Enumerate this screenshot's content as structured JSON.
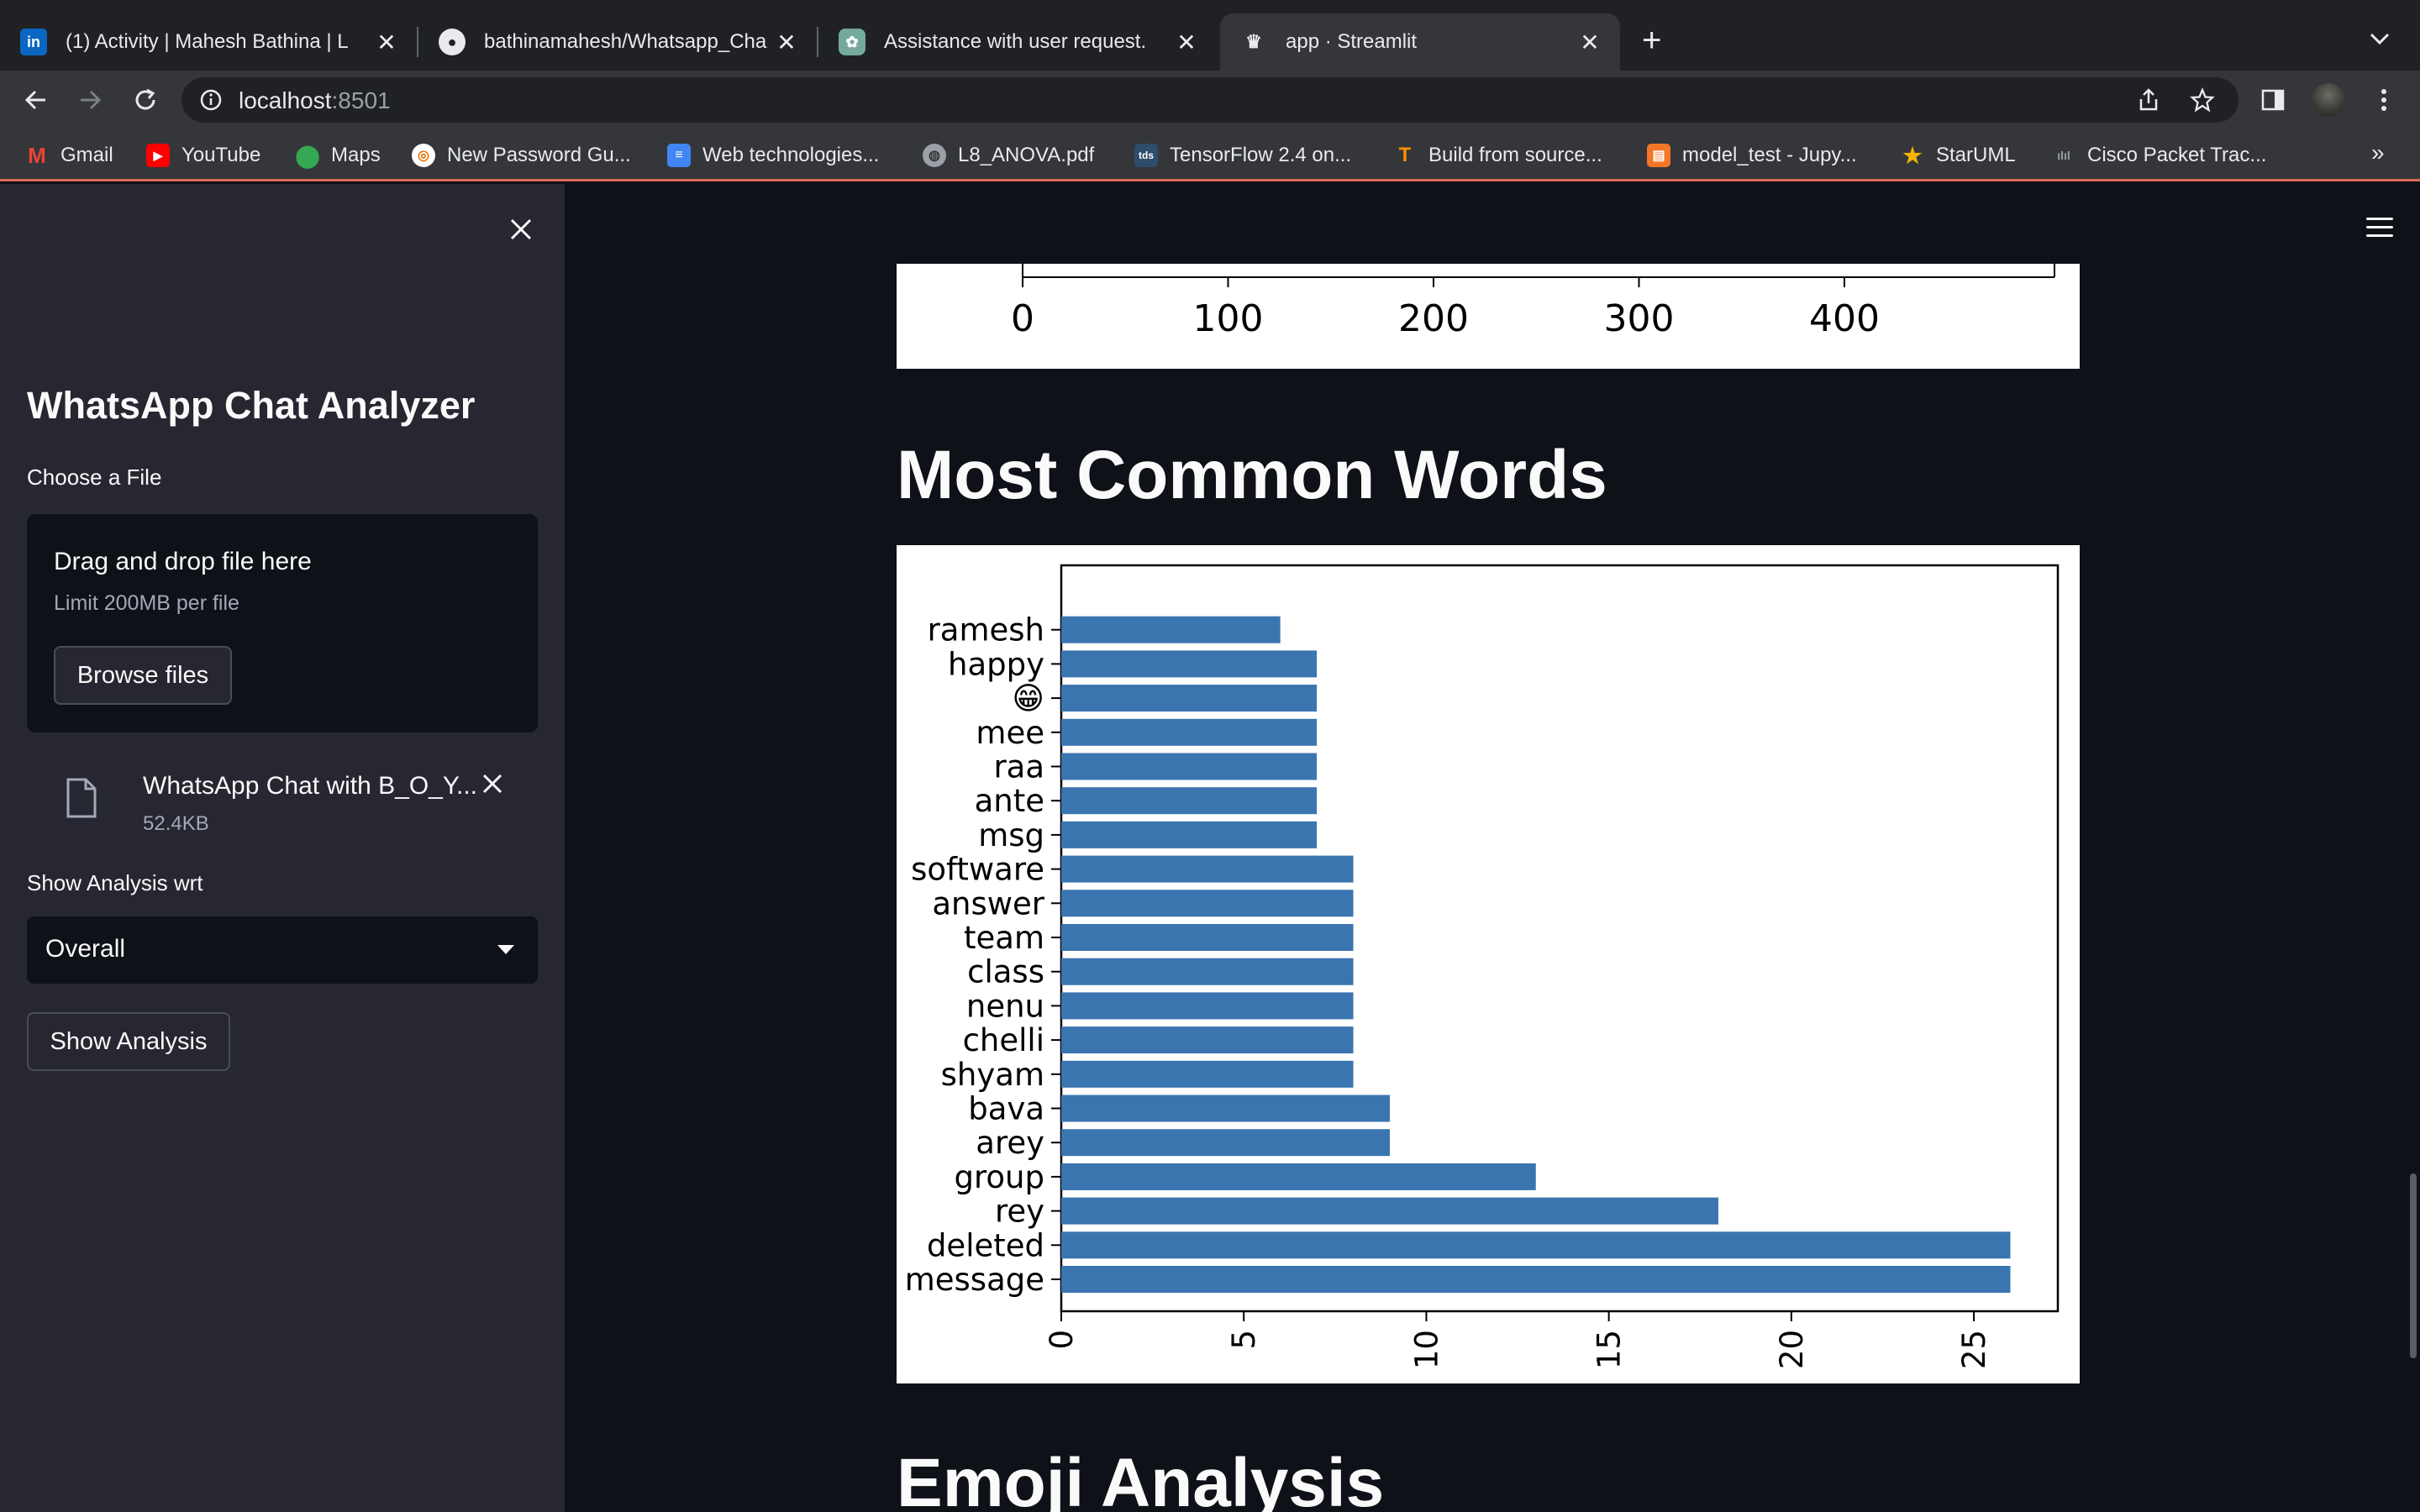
{
  "browser": {
    "tabs": [
      {
        "title": "(1) Activity | Mahesh Bathina | L",
        "icon": "linkedin-icon",
        "active": false
      },
      {
        "title": "bathinamahesh/Whatsapp_Cha",
        "icon": "github-icon",
        "active": false
      },
      {
        "title": "Assistance with user request.",
        "icon": "chatgpt-icon",
        "active": false
      },
      {
        "title": "app · Streamlit",
        "icon": "streamlit-icon",
        "active": true
      }
    ],
    "url_host": "localhost",
    "url_port": ":8501",
    "bookmarks": [
      {
        "label": "Gmail",
        "icon": "gmail-icon"
      },
      {
        "label": "YouTube",
        "icon": "youtube-icon"
      },
      {
        "label": "Maps",
        "icon": "maps-icon"
      },
      {
        "label": "New Password Gu...",
        "icon": "password-icon"
      },
      {
        "label": "Web technologies...",
        "icon": "docs-icon"
      },
      {
        "label": "L8_ANOVA.pdf",
        "icon": "globe-icon"
      },
      {
        "label": "TensorFlow 2.4 on...",
        "icon": "tds-icon"
      },
      {
        "label": "Build from source...",
        "icon": "tensorflow-icon"
      },
      {
        "label": "model_test - Jupy...",
        "icon": "jupyter-icon"
      },
      {
        "label": "StarUML",
        "icon": "staruml-icon"
      },
      {
        "label": "Cisco Packet Trac...",
        "icon": "cisco-icon"
      }
    ]
  },
  "sidebar": {
    "title": "WhatsApp Chat Analyzer",
    "file_label": "Choose a File",
    "drop_title": "Drag and drop file here",
    "drop_limit": "Limit 200MB per file",
    "browse_label": "Browse files",
    "file_name": "WhatsApp Chat with B_O_Y...",
    "file_size": "52.4KB",
    "analysis_label": "Show Analysis wrt",
    "select_value": "Overall",
    "show_button": "Show Analysis"
  },
  "main": {
    "heading_words": "Most Common Words",
    "heading_emoji": "Emoji Analysis",
    "prev_axis_ticks": [
      "0",
      "100",
      "200",
      "300",
      "400"
    ]
  },
  "chart_data": {
    "type": "bar",
    "orientation": "horizontal",
    "title": "",
    "xlabel": "",
    "ylabel": "",
    "categories": [
      "message",
      "deleted",
      "rey",
      "group",
      "arey",
      "bava",
      "shyam",
      "chelli",
      "nenu",
      "class",
      "team",
      "answer",
      "software",
      "msg",
      "ante",
      "raa",
      "mee",
      "😁",
      "happy",
      "ramesh"
    ],
    "values": [
      26,
      26,
      18,
      13,
      9,
      9,
      8,
      8,
      8,
      8,
      8,
      8,
      8,
      7,
      7,
      7,
      7,
      7,
      7,
      6
    ],
    "xlim": [
      0,
      27.3
    ],
    "x_ticks": [
      "0",
      "5",
      "10",
      "15",
      "20",
      "25"
    ],
    "bar_color": "#3a75b0",
    "grid": false
  }
}
